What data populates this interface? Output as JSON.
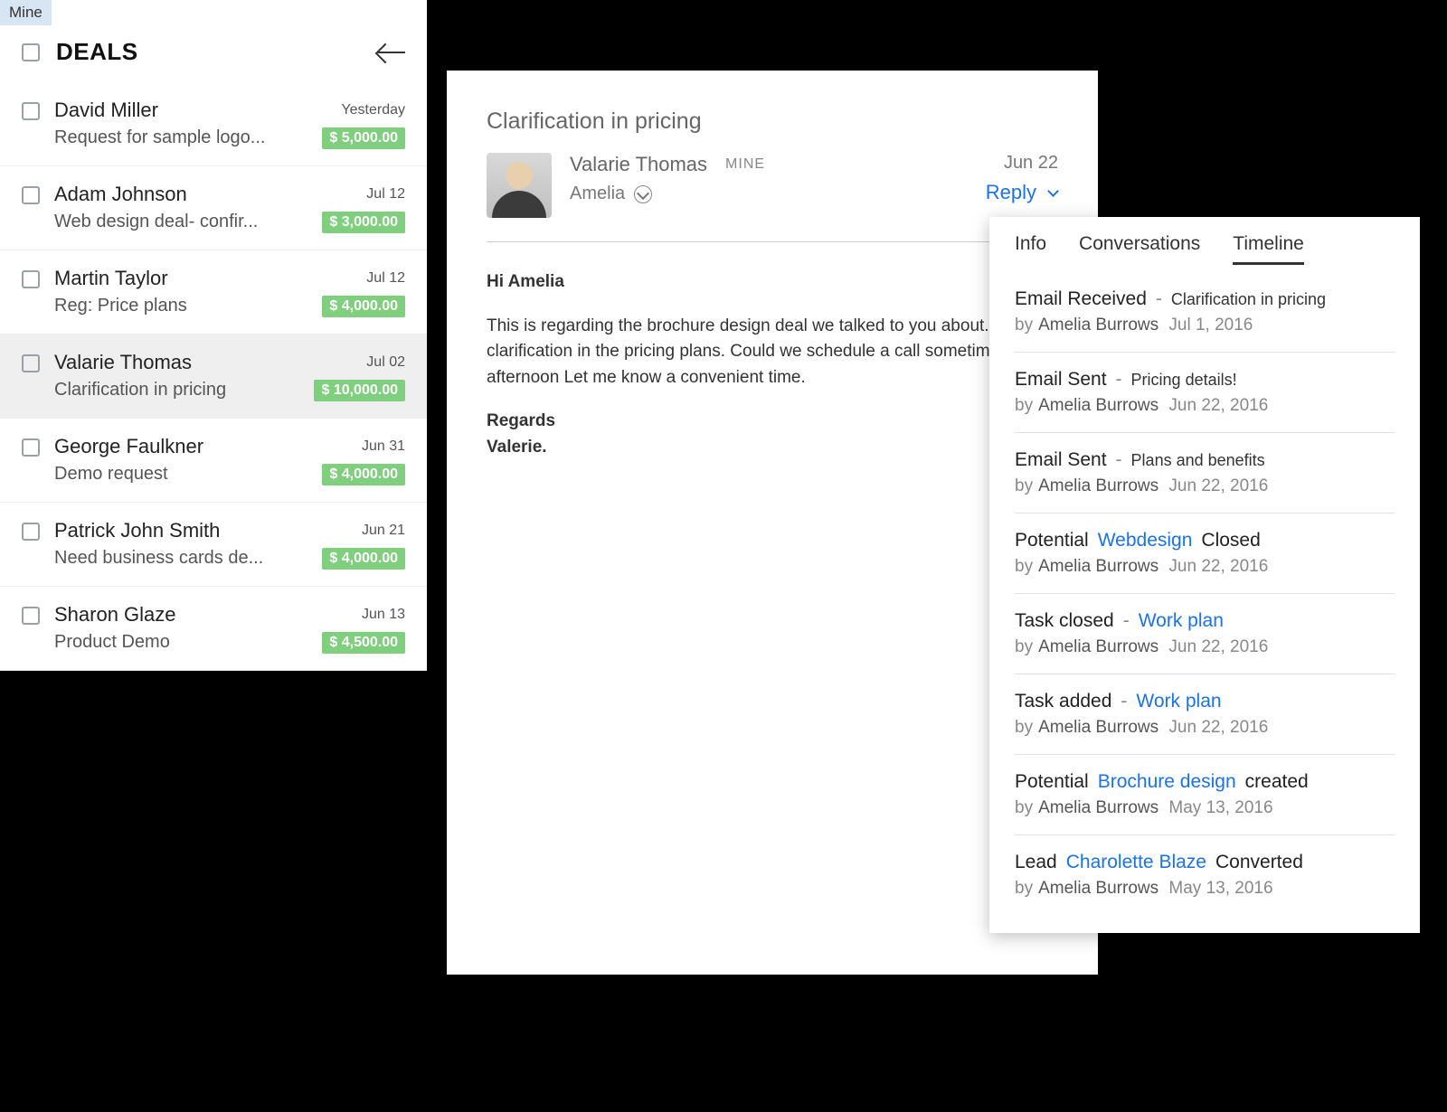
{
  "deals": {
    "tab_label": "Mine",
    "title": "DEALS",
    "items": [
      {
        "name": "David Miller",
        "date": "Yesterday",
        "subject": "Request for sample logo...",
        "amount": "$ 5,000.00",
        "selected": false
      },
      {
        "name": "Adam Johnson",
        "date": "Jul 12",
        "subject": "Web design deal- confir...",
        "amount": "$ 3,000.00",
        "selected": false
      },
      {
        "name": "Martin Taylor",
        "date": "Jul 12",
        "subject": "Reg: Price plans",
        "amount": "$ 4,000.00",
        "selected": false
      },
      {
        "name": "Valarie Thomas",
        "date": "Jul 02",
        "subject": "Clarification in pricing",
        "amount": "$ 10,000.00",
        "selected": true
      },
      {
        "name": "George Faulkner",
        "date": "Jun 31",
        "subject": "Demo request",
        "amount": "$ 4,000.00",
        "selected": false
      },
      {
        "name": "Patrick John Smith",
        "date": "Jun 21",
        "subject": "Need business cards de...",
        "amount": "$ 4,000.00",
        "selected": false
      },
      {
        "name": "Sharon Glaze",
        "date": "Jun 13",
        "subject": "Product Demo",
        "amount": "$ 4,500.00",
        "selected": false
      }
    ]
  },
  "email": {
    "subject": "Clarification in pricing",
    "sender": "Valarie Thomas",
    "badge": "MINE",
    "recipient": "Amelia",
    "date": "Jun 22",
    "reply_label": "Reply",
    "body": {
      "greeting": "Hi Amelia",
      "para": "This is regarding the brochure design deal we talked to you about. I have a clarification in the pricing plans. Could we schedule a call sometime this afternoon Let me know a convenient time.",
      "signoff1": "Regards",
      "signoff2": "Valerie."
    }
  },
  "timeline": {
    "tabs": {
      "info": "Info",
      "conversations": "Conversations",
      "timeline": "Timeline"
    },
    "by_label": "by",
    "entries": [
      {
        "type": "email_rx",
        "action": "Email Received",
        "sep": "-",
        "detail": "Clarification in pricing",
        "detail_small": true,
        "who": "Amelia Burrows",
        "when": "Jul 1, 2016"
      },
      {
        "type": "email_tx",
        "action": "Email Sent",
        "sep": "-",
        "detail": "Pricing details!",
        "detail_small": true,
        "who": "Amelia Burrows",
        "when": "Jun 22, 2016"
      },
      {
        "type": "email_tx",
        "action": "Email Sent",
        "sep": "-",
        "detail": "Plans and benefits",
        "detail_small": true,
        "who": "Amelia Burrows",
        "when": "Jun 22, 2016"
      },
      {
        "type": "potential_closed",
        "prefix": "Potential",
        "link": "Webdesign",
        "suffix": "Closed",
        "who": "Amelia Burrows",
        "when": "Jun 22, 2016"
      },
      {
        "type": "task_closed",
        "action": "Task closed",
        "sep": "-",
        "link": "Work plan",
        "who": "Amelia Burrows",
        "when": "Jun 22, 2016"
      },
      {
        "type": "task_added",
        "action": "Task added",
        "sep": "-",
        "link": "Work plan",
        "who": "Amelia Burrows",
        "when": "Jun 22, 2016"
      },
      {
        "type": "potential_created",
        "prefix": "Potential",
        "link": "Brochure design",
        "suffix": "created",
        "who": "Amelia Burrows",
        "when": "May 13, 2016"
      },
      {
        "type": "lead_converted",
        "prefix": "Lead",
        "link": "Charolette Blaze",
        "suffix": "Converted",
        "who": "Amelia Burrows",
        "when": "May 13, 2016"
      }
    ]
  }
}
